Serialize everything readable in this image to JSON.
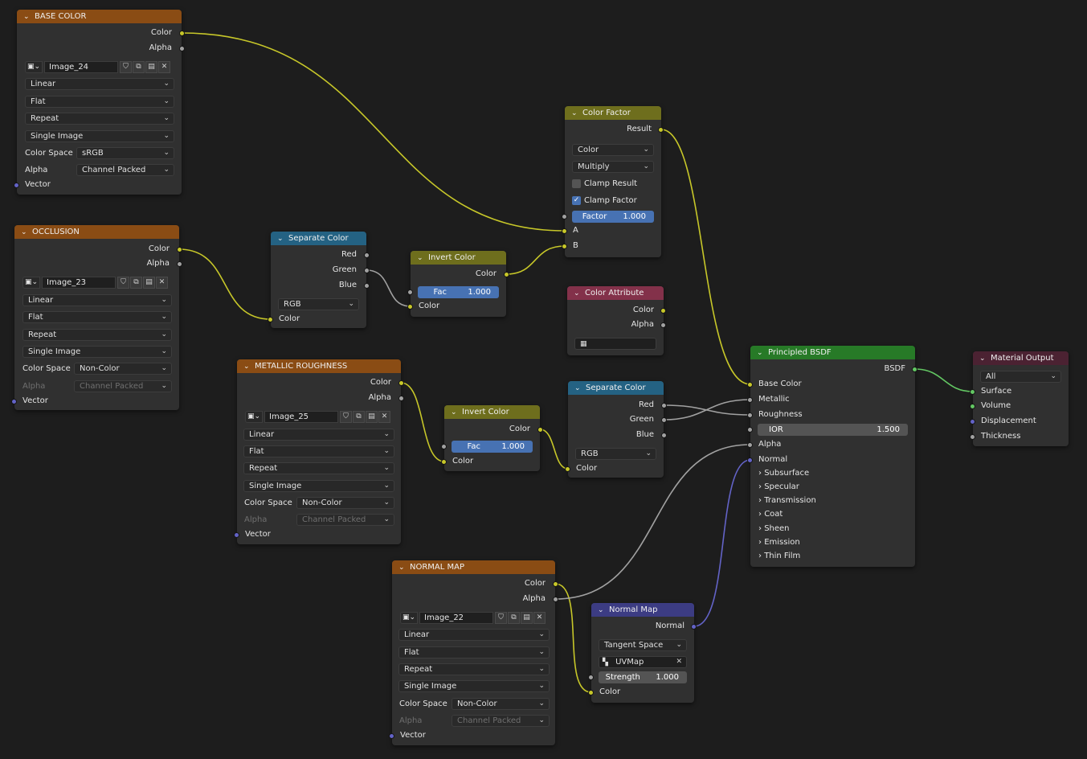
{
  "nodes": {
    "base_color": {
      "title": "BASE COLOR",
      "outputs": [
        "Color",
        "Alpha"
      ],
      "image": "Image_24",
      "interpolation": "Linear",
      "projection": "Flat",
      "extension": "Repeat",
      "source": "Single Image",
      "color_space_label": "Color Space",
      "color_space": "sRGB",
      "alpha_label": "Alpha",
      "alpha_mode": "Channel Packed",
      "vector": "Vector"
    },
    "occlusion": {
      "title": "OCCLUSION",
      "outputs": [
        "Color",
        "Alpha"
      ],
      "image": "Image_23",
      "interpolation": "Linear",
      "projection": "Flat",
      "extension": "Repeat",
      "source": "Single Image",
      "color_space_label": "Color Space",
      "color_space": "Non-Color",
      "alpha_label": "Alpha",
      "alpha_mode": "Channel Packed",
      "vector": "Vector"
    },
    "metallic_roughness": {
      "title": "METALLIC ROUGHNESS",
      "outputs": [
        "Color",
        "Alpha"
      ],
      "image": "Image_25",
      "interpolation": "Linear",
      "projection": "Flat",
      "extension": "Repeat",
      "source": "Single Image",
      "color_space_label": "Color Space",
      "color_space": "Non-Color",
      "alpha_label": "Alpha",
      "alpha_mode": "Channel Packed",
      "vector": "Vector"
    },
    "normal_map_tex": {
      "title": "NORMAL MAP",
      "outputs": [
        "Color",
        "Alpha"
      ],
      "image": "Image_22",
      "interpolation": "Linear",
      "projection": "Flat",
      "extension": "Repeat",
      "source": "Single Image",
      "color_space_label": "Color Space",
      "color_space": "Non-Color",
      "alpha_label": "Alpha",
      "alpha_mode": "Channel Packed",
      "vector": "Vector"
    },
    "separate_color_1": {
      "title": "Separate Color",
      "outputs": [
        "Red",
        "Green",
        "Blue"
      ],
      "mode": "RGB",
      "input": "Color"
    },
    "separate_color_2": {
      "title": "Separate Color",
      "outputs": [
        "Red",
        "Green",
        "Blue"
      ],
      "mode": "RGB",
      "input": "Color"
    },
    "invert_color_1": {
      "title": "Invert Color",
      "output": "Color",
      "fac_label": "Fac",
      "fac_value": "1.000",
      "input": "Color"
    },
    "invert_color_2": {
      "title": "Invert Color",
      "output": "Color",
      "fac_label": "Fac",
      "fac_value": "1.000",
      "input": "Color"
    },
    "color_factor": {
      "title": "Color Factor",
      "output": "Result",
      "data_type": "Color",
      "blend": "Multiply",
      "clamp_result": "Clamp Result",
      "clamp_result_checked": false,
      "clamp_factor": "Clamp Factor",
      "clamp_factor_checked": true,
      "factor_label": "Factor",
      "factor_value": "1.000",
      "input_a": "A",
      "input_b": "B"
    },
    "color_attribute": {
      "title": "Color Attribute",
      "outputs": [
        "Color",
        "Alpha"
      ],
      "name": ""
    },
    "principled": {
      "title": "Principled BSDF",
      "output": "BSDF",
      "inputs": [
        "Base Color",
        "Metallic",
        "Roughness"
      ],
      "ior_label": "IOR",
      "ior_value": "1.500",
      "inputs2": [
        "Alpha",
        "Normal"
      ],
      "panels": [
        "Subsurface",
        "Specular",
        "Transmission",
        "Coat",
        "Sheen",
        "Emission",
        "Thin Film"
      ]
    },
    "material_output": {
      "title": "Material Output",
      "target": "All",
      "inputs": [
        "Surface",
        "Volume",
        "Displacement",
        "Thickness"
      ]
    },
    "normal_map": {
      "title": "Normal Map",
      "output": "Normal",
      "space": "Tangent Space",
      "uv_map": "UVMap",
      "strength_label": "Strength",
      "strength_value": "1.000",
      "input": "Color"
    }
  },
  "colors": {
    "header_texture": "#8a4c14",
    "header_converter": "#246283",
    "header_color": "#6e6e1d",
    "header_input": "#83314a",
    "header_shader": "#277a27",
    "header_output": "#4b2232",
    "header_vector": "#3c3c83",
    "socket_color": "#c7c729",
    "socket_float": "#a1a1a1",
    "socket_vector": "#6363c7",
    "socket_shader": "#63c763"
  },
  "links": [
    {
      "from": "BASE COLOR.Color",
      "to": "Color Factor.A"
    },
    {
      "from": "OCCLUSION.Color",
      "to": "Separate Color.Color"
    },
    {
      "from": "Separate Color.Green",
      "to": "Invert Color.Color"
    },
    {
      "from": "Invert Color.Color",
      "to": "Color Factor.B"
    },
    {
      "from": "Color Factor.Result",
      "to": "Principled BSDF.Base Color"
    },
    {
      "from": "METALLIC ROUGHNESS.Color",
      "to": "Invert Color.Color"
    },
    {
      "from": "Invert Color.Color",
      "to": "Separate Color.Color"
    },
    {
      "from": "Separate Color.Red",
      "to": "Principled BSDF.Roughness"
    },
    {
      "from": "Separate Color.Green",
      "to": "Principled BSDF.Metallic"
    },
    {
      "from": "NORMAL MAP.Color",
      "to": "Normal Map.Color"
    },
    {
      "from": "NORMAL MAP.Alpha",
      "to": "Principled BSDF.Alpha"
    },
    {
      "from": "Normal Map.Normal",
      "to": "Principled BSDF.Normal"
    },
    {
      "from": "Principled BSDF.BSDF",
      "to": "Material Output.Surface"
    }
  ]
}
